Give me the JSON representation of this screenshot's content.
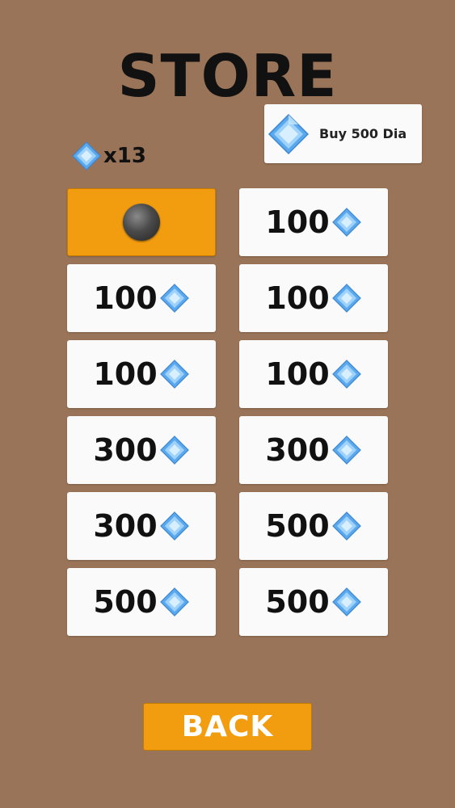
{
  "store": {
    "title": "STORE",
    "buy_button_label": "Buy 500 Dia",
    "balance_text": "x13",
    "items": [
      {
        "price": null,
        "selected": true,
        "icon": "ball-icon"
      },
      {
        "price": "100",
        "selected": false
      },
      {
        "price": "100",
        "selected": false
      },
      {
        "price": "100",
        "selected": false
      },
      {
        "price": "100",
        "selected": false
      },
      {
        "price": "100",
        "selected": false
      },
      {
        "price": "300",
        "selected": false
      },
      {
        "price": "300",
        "selected": false
      },
      {
        "price": "300",
        "selected": false
      },
      {
        "price": "500",
        "selected": false
      },
      {
        "price": "500",
        "selected": false
      },
      {
        "price": "500",
        "selected": false
      }
    ],
    "back_label": "BACK"
  },
  "colors": {
    "background": "#9a7458",
    "accent": "#f29c0f",
    "tile": "#fafafa",
    "diamond": "#6fb4f0"
  },
  "icons": {
    "currency": "diamond-icon",
    "selected_item": "ball-icon"
  }
}
